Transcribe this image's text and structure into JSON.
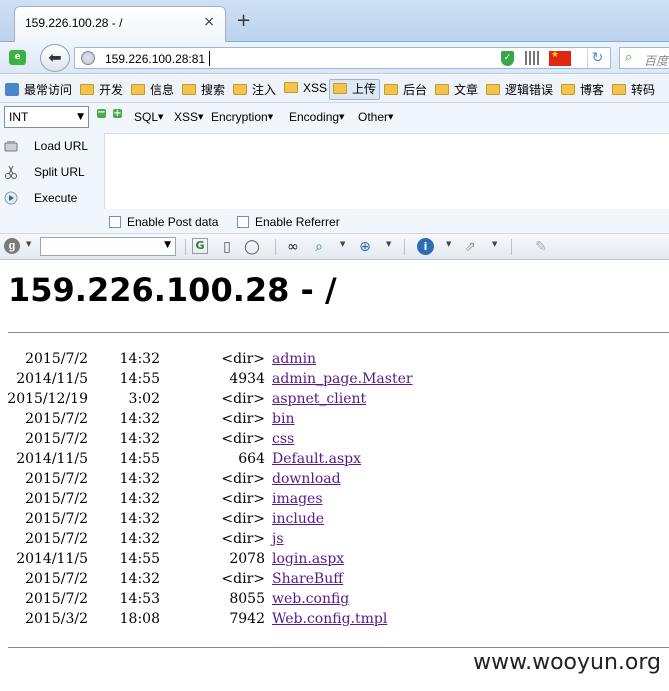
{
  "tab": {
    "title": "159.226.100.28 - /",
    "close": "×",
    "new_tab": "+"
  },
  "nav": {
    "url": "159.226.100.28:81",
    "search_placeholder": "百度",
    "app_icon": "e",
    "back_icon": "arrow-left-icon"
  },
  "bookmarks": [
    "最常访问",
    "开发",
    "信息",
    "搜索",
    "注入",
    "XSS",
    "上传",
    "后台",
    "文章",
    "逻辑错误",
    "博客",
    "转码"
  ],
  "hackbar": {
    "select_value": "INT",
    "menus": [
      "SQL",
      "XSS",
      "Encryption",
      "Encoding",
      "Other"
    ],
    "actions": [
      "Load URL",
      "Split URL",
      "Execute"
    ],
    "post_label": "Enable Post data",
    "referrer_label": "Enable Referrer"
  },
  "page": {
    "title": "159.226.100.28 - /",
    "entries": [
      {
        "date": "2015/7/2",
        "time": "14:32",
        "size": "<dir>",
        "name": "admin"
      },
      {
        "date": "2014/11/5",
        "time": "14:55",
        "size": "4934",
        "name": "admin_page.Master"
      },
      {
        "date": "2015/12/19",
        "time": "3:02",
        "size": "<dir>",
        "name": "aspnet_client"
      },
      {
        "date": "2015/7/2",
        "time": "14:32",
        "size": "<dir>",
        "name": "bin"
      },
      {
        "date": "2015/7/2",
        "time": "14:32",
        "size": "<dir>",
        "name": "css"
      },
      {
        "date": "2014/11/5",
        "time": "14:55",
        "size": "664",
        "name": "Default.aspx"
      },
      {
        "date": "2015/7/2",
        "time": "14:32",
        "size": "<dir>",
        "name": "download"
      },
      {
        "date": "2015/7/2",
        "time": "14:32",
        "size": "<dir>",
        "name": "images"
      },
      {
        "date": "2015/7/2",
        "time": "14:32",
        "size": "<dir>",
        "name": "include"
      },
      {
        "date": "2015/7/2",
        "time": "14:32",
        "size": "<dir>",
        "name": "js"
      },
      {
        "date": "2014/11/5",
        "time": "14:55",
        "size": "2078",
        "name": "login.aspx"
      },
      {
        "date": "2015/7/2",
        "time": "14:32",
        "size": "<dir>",
        "name": "ShareBuff"
      },
      {
        "date": "2015/7/2",
        "time": "14:53",
        "size": "8055",
        "name": "web.config"
      },
      {
        "date": "2015/3/2",
        "time": "18:08",
        "size": "7942",
        "name": "Web.config.tmpl"
      }
    ],
    "watermark": "www.wooyun.org"
  },
  "colors": {
    "link_visited": "#551a8b",
    "tab_bar": "#bcd3ee",
    "flag": "#de2910"
  }
}
